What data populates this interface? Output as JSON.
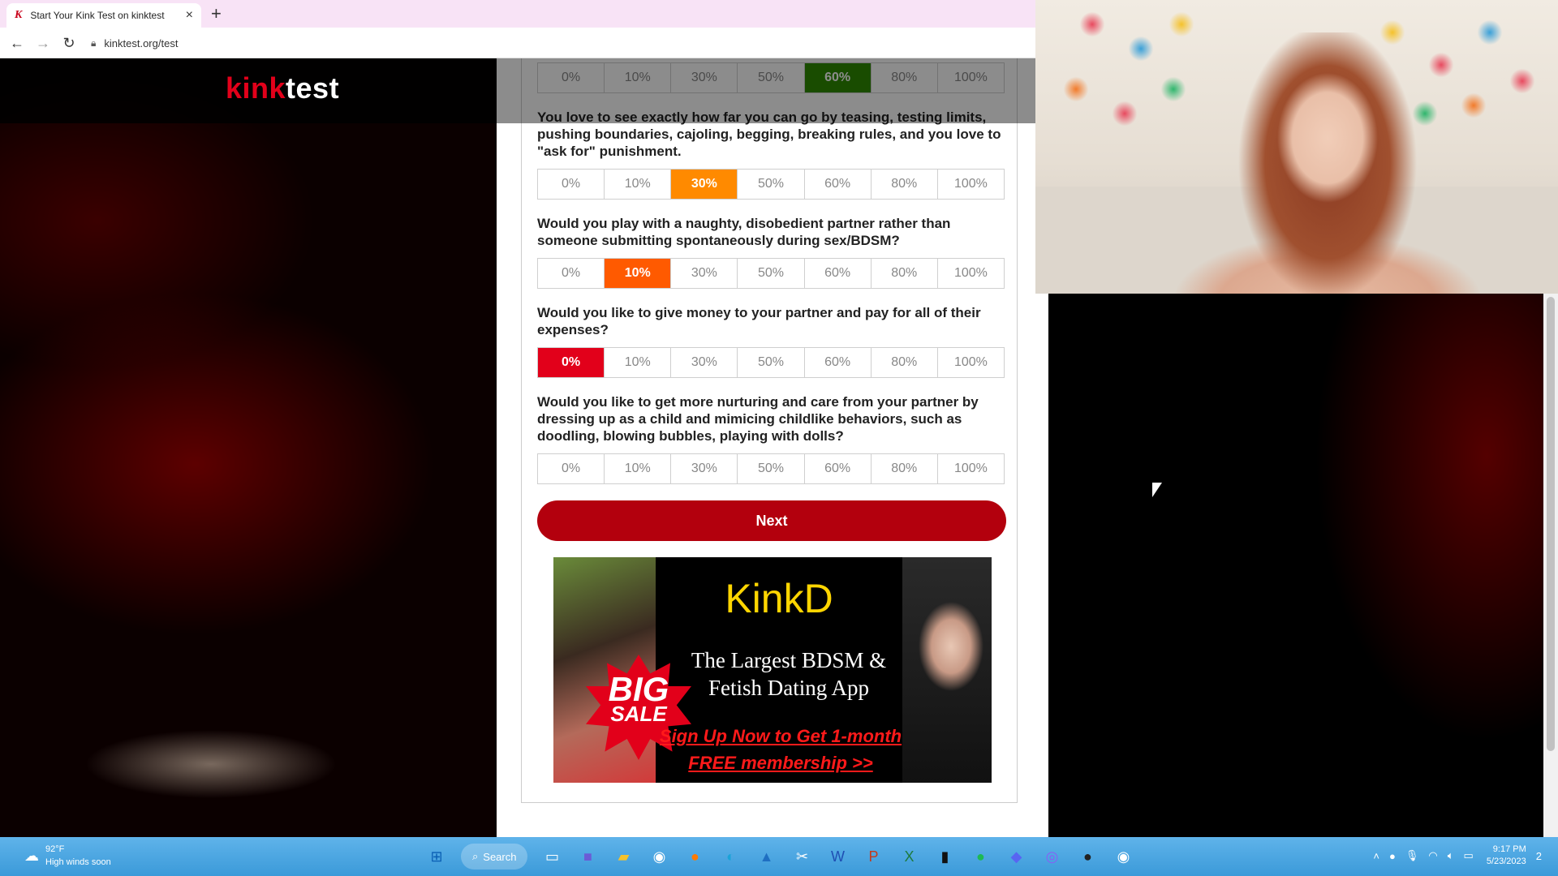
{
  "browser": {
    "tab_title": "Start Your Kink Test on kinktest",
    "tab_favicon": "K",
    "url": "kinktest.org/test"
  },
  "site": {
    "logo_part1": "kink",
    "logo_part2": "test"
  },
  "questions": [
    {
      "text": "",
      "options": [
        "0%",
        "10%",
        "30%",
        "50%",
        "60%",
        "80%",
        "100%"
      ],
      "selected": "60%",
      "selected_color": "#2e8b00"
    },
    {
      "text": "You love to see exactly how far you can go by teasing, testing limits, pushing boundaries, cajoling, begging, breaking rules, and you love to \"ask for\" punishment.",
      "options": [
        "0%",
        "10%",
        "30%",
        "50%",
        "60%",
        "80%",
        "100%"
      ],
      "selected": "30%",
      "selected_color": "#ff8a00"
    },
    {
      "text": "Would you play with a naughty, disobedient partner rather than someone submitting spontaneously during sex/BDSM?",
      "options": [
        "0%",
        "10%",
        "30%",
        "50%",
        "60%",
        "80%",
        "100%"
      ],
      "selected": "10%",
      "selected_color": "#ff5a00"
    },
    {
      "text": "Would you like to give money to your partner and pay for all of their expenses?",
      "options": [
        "0%",
        "10%",
        "30%",
        "50%",
        "60%",
        "80%",
        "100%"
      ],
      "selected": "0%",
      "selected_color": "#e2001a"
    },
    {
      "text": "Would you like to get more nurturing and care from your partner by dressing up as a child and mimicing childlike behaviors, such as doodling, blowing bubbles, playing with dolls?",
      "options": [
        "0%",
        "10%",
        "30%",
        "50%",
        "60%",
        "80%",
        "100%"
      ],
      "selected": "",
      "selected_color": ""
    }
  ],
  "next_label": "Next",
  "ad": {
    "brand": "KinkD",
    "tagline_line1": "The Largest BDSM &",
    "tagline_line2": "Fetish Dating App",
    "cta_line1": "Sign Up Now to Get 1-month",
    "cta_line2": "FREE membership >>",
    "burst_line1": "BIG",
    "burst_line2": "SALE"
  },
  "taskbar": {
    "weather_temp": "92°F",
    "weather_text": "High winds soon",
    "search_label": "Search",
    "time": "9:17 PM",
    "date": "5/23/2023",
    "notif_count": "2"
  }
}
